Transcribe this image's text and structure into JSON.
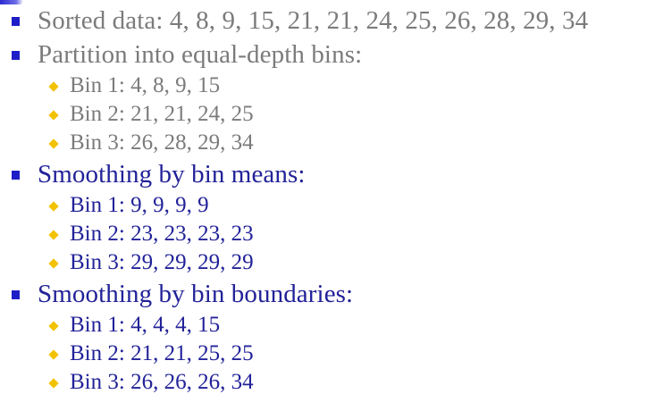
{
  "sections": [
    {
      "heading": "Sorted data: 4, 8, 9, 15, 21, 21, 24, 25, 26, 28, 29, 34",
      "items": []
    },
    {
      "heading": "Partition into equal-depth bins:",
      "items": [
        "Bin 1:  4, 8, 9, 15",
        "Bin 2:  21, 21, 24, 25",
        "Bin 3:  26, 28, 29, 34"
      ]
    },
    {
      "heading": "Smoothing by bin means:",
      "items": [
        "Bin 1:  9, 9, 9, 9",
        "Bin 2:  23, 23, 23, 23",
        "Bin 3:  29, 29, 29, 29"
      ]
    },
    {
      "heading": "Smoothing by bin boundaries:",
      "items": [
        "Bin 1:  4, 4, 4, 15",
        "Bin 2:  21, 21, 25, 25",
        "Bin 3:  26, 26, 26, 34"
      ]
    }
  ],
  "colors": {
    "grey_text": "#7b7b7b",
    "blue_text": "#222299",
    "square_bullet": "#1e1ec8",
    "diamond_bullet": "#f2c200"
  }
}
